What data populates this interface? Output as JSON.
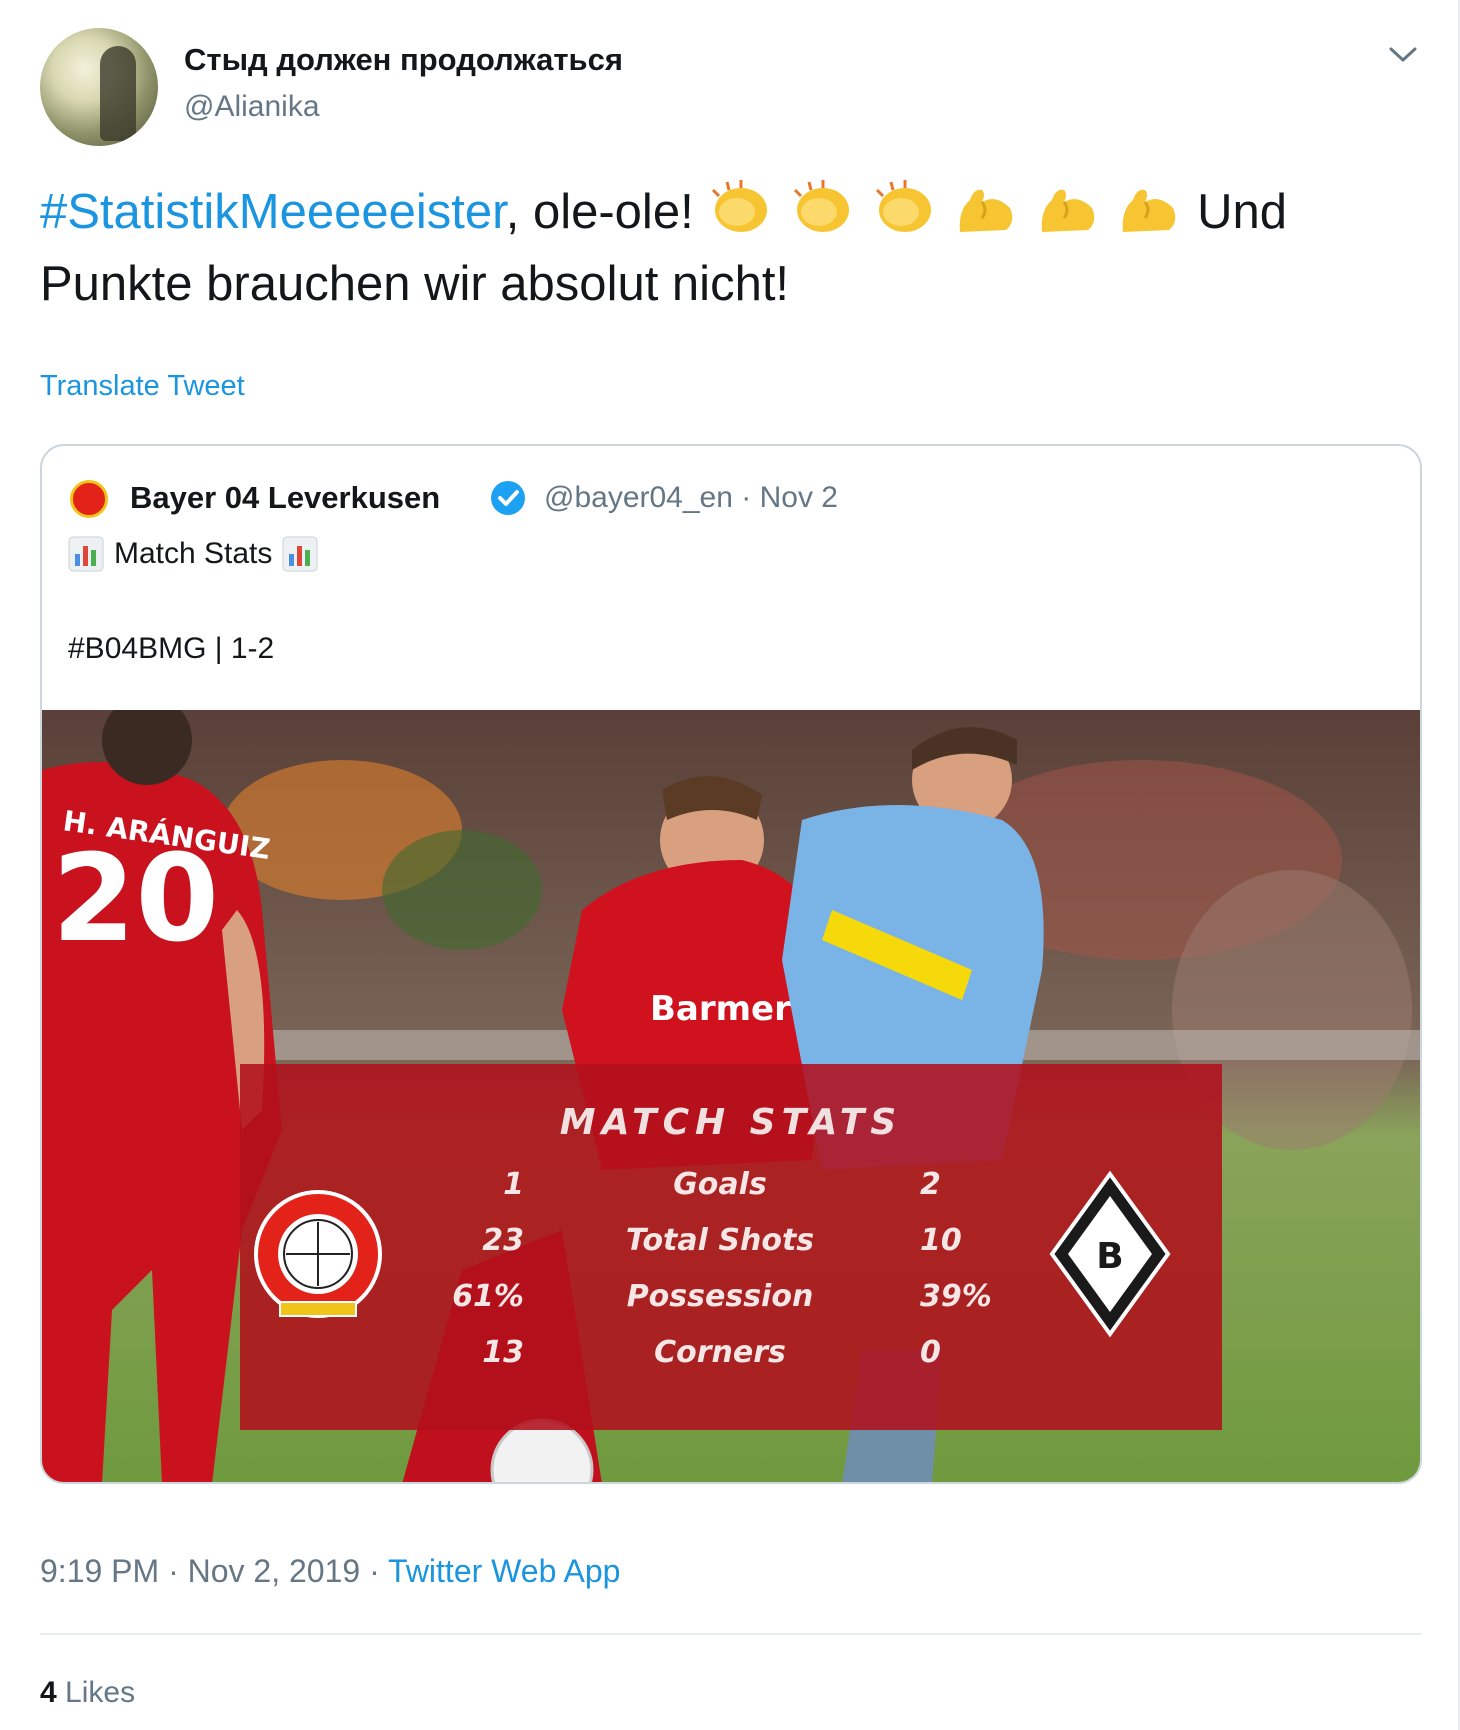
{
  "tweet": {
    "display_name": "Стыд должен продолжаться",
    "handle": "@Alianika",
    "hashtag": "#StatistikMeeeeeister",
    "text_after_hashtag": ", ole-ole!",
    "text_tail": "Und Punkte brauchen wir absolut nicht!",
    "emojis": [
      "clapping-hands",
      "clapping-hands",
      "clapping-hands",
      "flexed-biceps",
      "flexed-biceps",
      "flexed-biceps"
    ],
    "translate_label": "Translate Tweet",
    "time": "9:19 PM",
    "separator": " · ",
    "date": "Nov 2, 2019",
    "source": "Twitter Web App",
    "likes_count": "4",
    "likes_label": "Likes"
  },
  "quoted_tweet": {
    "name": "Bayer 04 Leverkusen",
    "handle": "@bayer04_en",
    "date": "Nov 2",
    "line1": "Match Stats",
    "line2": "#B04BMG | 1-2",
    "verified": true
  },
  "match_stats": {
    "title": "MATCH STATS",
    "rows": [
      {
        "home": "1",
        "label": "Goals",
        "away": "2"
      },
      {
        "home": "23",
        "label": "Total Shots",
        "away": "10"
      },
      {
        "home": "61%",
        "label": "Possession",
        "away": "39%"
      },
      {
        "home": "13",
        "label": "Corners",
        "away": "0"
      }
    ],
    "player_number": "20",
    "player_name": "H. ARÁNGUIZ",
    "shirt_sponsor": "Barmer"
  },
  "colors": {
    "link": "#1b95e0",
    "secondary_text": "#657786",
    "stats_panel": "#b0101d",
    "verified": "#1da1f2"
  }
}
